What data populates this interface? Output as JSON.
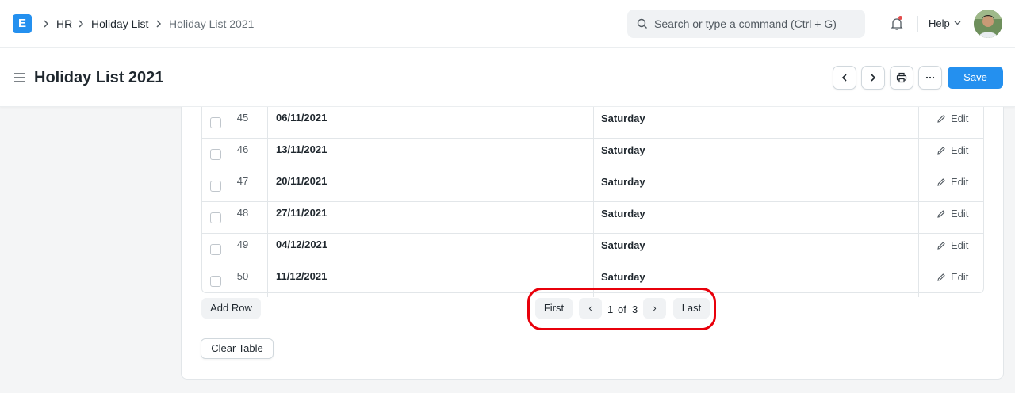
{
  "navbar": {
    "logo": "E",
    "breadcrumbs": [
      "HR",
      "Holiday List",
      "Holiday List 2021"
    ],
    "search_placeholder": "Search or type a command (Ctrl + G)",
    "help_label": "Help"
  },
  "page": {
    "title": "Holiday List 2021",
    "save_label": "Save"
  },
  "table": {
    "rows": [
      {
        "idx": "45",
        "date": "06/11/2021",
        "description": "Saturday",
        "edit": "Edit"
      },
      {
        "idx": "46",
        "date": "13/11/2021",
        "description": "Saturday",
        "edit": "Edit"
      },
      {
        "idx": "47",
        "date": "20/11/2021",
        "description": "Saturday",
        "edit": "Edit"
      },
      {
        "idx": "48",
        "date": "27/11/2021",
        "description": "Saturday",
        "edit": "Edit"
      },
      {
        "idx": "49",
        "date": "04/12/2021",
        "description": "Saturday",
        "edit": "Edit"
      },
      {
        "idx": "50",
        "date": "11/12/2021",
        "description": "Saturday",
        "edit": "Edit"
      }
    ],
    "add_row_label": "Add Row",
    "clear_table_label": "Clear Table"
  },
  "pagination": {
    "first_label": "First",
    "prev_symbol": "‹",
    "current_page": "1",
    "of_label": "of",
    "total_pages": "3",
    "next_symbol": "›",
    "last_label": "Last"
  },
  "colors": {
    "primary": "#2490ef",
    "highlight": "#e8000b",
    "notification_dot": "#e24c4c"
  }
}
